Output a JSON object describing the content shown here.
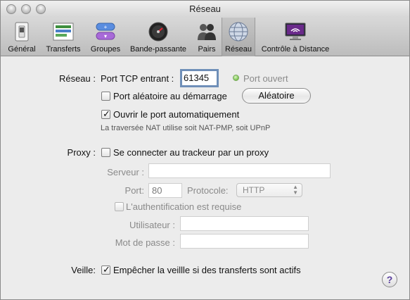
{
  "window": {
    "title": "Réseau"
  },
  "toolbar": {
    "items": [
      {
        "label": "Général",
        "icon": "general-switch-icon"
      },
      {
        "label": "Transferts",
        "icon": "transfers-icon"
      },
      {
        "label": "Groupes",
        "icon": "groups-icon"
      },
      {
        "label": "Bande-passante",
        "icon": "bandwidth-gauge-icon"
      },
      {
        "label": "Pairs",
        "icon": "peers-icon"
      },
      {
        "label": "Réseau",
        "icon": "network-globe-icon",
        "selected": true
      },
      {
        "label": "Contrôle à Distance",
        "icon": "remote-control-icon"
      }
    ]
  },
  "network": {
    "section_label": "Réseau :",
    "port_label": "Port TCP entrant :",
    "port_value": "61345",
    "port_status": "Port ouvert",
    "status_color": "#7cc24f",
    "random_port_label": "Port aléatoire au démarrage",
    "random_port_checked": false,
    "random_button": "Aléatoire",
    "auto_map_label": "Ouvrir le port automatiquement",
    "auto_map_checked": true,
    "nat_hint": "La traversée NAT utilise soit NAT-PMP, soit UPnP"
  },
  "proxy": {
    "section_label": "Proxy :",
    "enable_label": "Se connecter au trackeur par un proxy",
    "enabled": false,
    "server_label": "Serveur :",
    "server_value": "",
    "port_label": "Port:",
    "port_value": "80",
    "protocol_label": "Protocole:",
    "protocol_value": "HTTP",
    "auth_label": "L'authentification est requise",
    "auth_checked": false,
    "user_label": "Utilisateur :",
    "user_value": "",
    "password_label": "Mot de passe :",
    "password_value": ""
  },
  "sleep": {
    "section_label": "Veille:",
    "prevent_label": "Empêcher la veillle si des transferts sont actifs",
    "prevent_checked": true
  },
  "help": {
    "label": "?"
  }
}
